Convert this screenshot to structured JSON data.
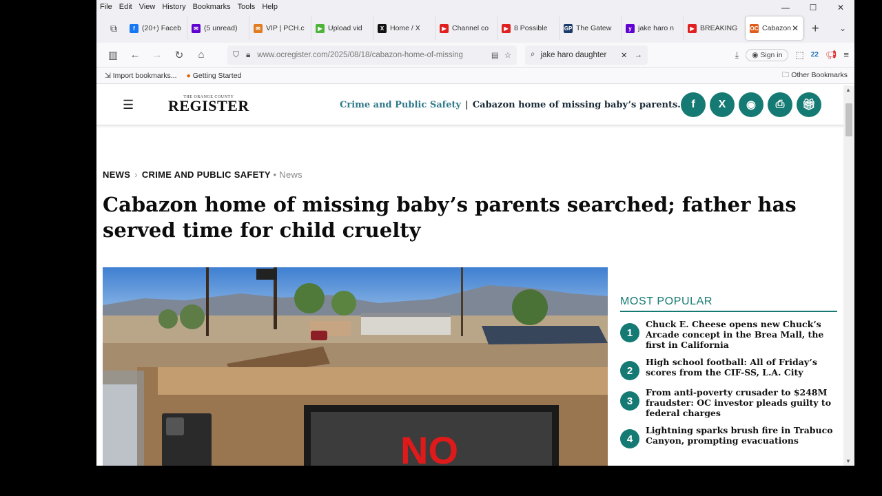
{
  "menu": [
    "File",
    "Edit",
    "View",
    "History",
    "Bookmarks",
    "Tools",
    "Help"
  ],
  "tabs": [
    {
      "label": "(20+) Faceb",
      "icon": "facebook-icon",
      "color": "#1877f2",
      "glyph": "f"
    },
    {
      "label": "(5 unread)",
      "icon": "yahoo-mail-icon",
      "color": "#6001d2",
      "glyph": "✉"
    },
    {
      "label": "VIP | PCH.c",
      "icon": "envelope-icon",
      "color": "#e07b1f",
      "glyph": "✉"
    },
    {
      "label": "Upload vid",
      "icon": "rumble-icon",
      "color": "#4fb33a",
      "glyph": "▶"
    },
    {
      "label": "Home / X",
      "icon": "x-icon",
      "color": "#111111",
      "glyph": "X"
    },
    {
      "label": "Channel co",
      "icon": "youtube-icon",
      "color": "#e02020",
      "glyph": "▶"
    },
    {
      "label": "8 Possible",
      "icon": "youtube-icon",
      "color": "#e02020",
      "glyph": "▶"
    },
    {
      "label": "The Gatew",
      "icon": "gp-icon",
      "color": "#1a3a6b",
      "glyph": "GP"
    },
    {
      "label": "jake haro n",
      "icon": "yahoo-icon",
      "color": "#6001d2",
      "glyph": "y"
    },
    {
      "label": "BREAKING",
      "icon": "youtube-icon",
      "color": "#e02020",
      "glyph": "▶"
    },
    {
      "label": "Cabazon",
      "icon": "ocr-icon",
      "color": "#e05a1a",
      "glyph": "OC",
      "active": true
    }
  ],
  "url": "www.ocregister.com/2025/08/18/cabazon-home-of-missing",
  "search": "jake haro daughter",
  "signin": "Sign in",
  "extension_badge": "22",
  "bookmarks": {
    "import": "Import bookmarks...",
    "getting_started": "Getting Started",
    "other": "Other Bookmarks"
  },
  "site": {
    "logo_small": "THE ORANGE COUNTY",
    "logo_big": "REGISTER",
    "section": "Crime and Public Safety",
    "header_article": "Cabazon home of missing baby’s parents..."
  },
  "crumbs": {
    "news": "NEWS",
    "section": "CRIME AND PUBLIC SAFETY",
    "tag": "• News"
  },
  "headline": "Cabazon home of missing baby’s parents searched; father has served time for child cruelty",
  "photo_sign_text": "NO",
  "popular": {
    "title": "MOST POPULAR",
    "items": [
      {
        "num": "1",
        "title": "Chuck E. Cheese opens new Chuck’s Arcade concept in the Brea Mall, the first in California"
      },
      {
        "num": "2",
        "title": "High school football: All of Friday’s scores from the CIF-SS, L.A. City"
      },
      {
        "num": "3",
        "title": "From anti-poverty crusader to $248M fraudster: OC investor pleads guilty to federal charges"
      },
      {
        "num": "4",
        "title": "Lightning sparks brush fire in Trabuco Canyon, prompting evacuations"
      }
    ]
  },
  "brand_color": "#157a73"
}
